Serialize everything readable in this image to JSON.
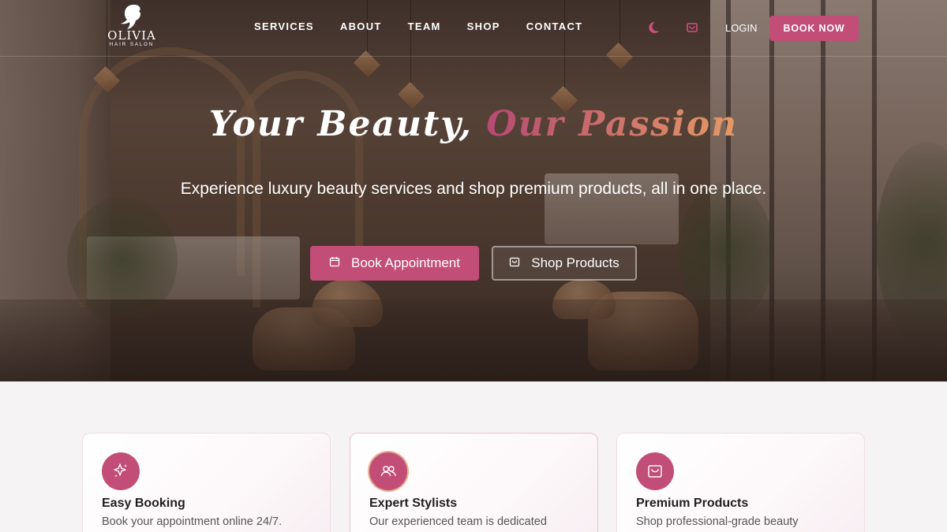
{
  "brand": {
    "name": "OLIVIA",
    "tagline": "HAIR SALON"
  },
  "nav": {
    "links": [
      "SERVICES",
      "ABOUT",
      "TEAM",
      "SHOP",
      "CONTACT"
    ],
    "icons": [
      "moon-icon",
      "cart-icon"
    ],
    "login_label": "LOGIN",
    "book_label": "BOOK NOW"
  },
  "hero": {
    "title_main": "Your Beauty,",
    "title_accent": "Our Passion",
    "subtitle": "Experience luxury beauty services and shop premium products, all in one place.",
    "primary_button": "Book Appointment",
    "secondary_button": "Shop Products"
  },
  "features": [
    {
      "icon": "sparkle-icon",
      "title": "Easy Booking",
      "text": "Book your appointment online 24/7."
    },
    {
      "icon": "users-icon",
      "title": "Expert Stylists",
      "text": "Our experienced team is dedicated"
    },
    {
      "icon": "shopping-bag-icon",
      "title": "Premium Products",
      "text": "Shop professional-grade beauty"
    }
  ],
  "colors": {
    "accent": "#c24d77",
    "accent_gradient_end": "#e59a64",
    "page_bg": "#f6f3f4"
  }
}
